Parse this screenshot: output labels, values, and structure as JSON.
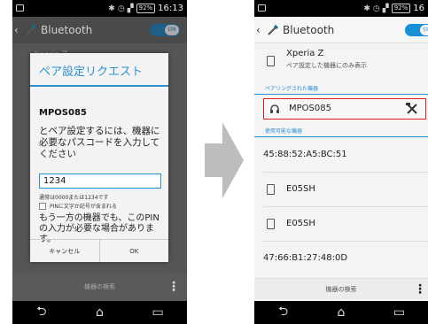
{
  "left_phone": {
    "status": {
      "time": "16:13",
      "battery": "92%"
    },
    "actionbar": {
      "back": "‹",
      "title": "Bluetooth",
      "toggle": "ON"
    },
    "background_item": "Xperia Z",
    "dialog": {
      "title": "ペア設定リクエスト",
      "device": "MPOS085",
      "message": "とペア設定するには、機器に必要なパスコードを入力してください",
      "input_value": "1234",
      "hint": "通常は0000または1234です",
      "checkbox_label": "PINに文字か記号が含まれる",
      "note": "もう一方の機器でも、このPINの入力が必要な場合があります。",
      "cancel": "キャンセル",
      "ok": "OK"
    },
    "bottombar": {
      "label": "機器の検索"
    }
  },
  "right_phone": {
    "status": {
      "time": "16",
      "battery": "92%"
    },
    "actionbar": {
      "back": "‹",
      "title": "Bluetooth",
      "toggle": "ON"
    },
    "own_device": {
      "name": "Xperia Z",
      "sub": "ペア設定した機器にのみ表示"
    },
    "paired_header": "ペアリングされた機器",
    "paired_device": "MPOS085",
    "available_header": "使用可能な機器",
    "available": [
      {
        "name": "45:88:52:A5:BC:51",
        "icon": "none"
      },
      {
        "name": "E05SH",
        "icon": "phone-icon"
      },
      {
        "name": "E05SH",
        "icon": "phone-icon"
      },
      {
        "name": "47:66:B1:27:48:0D",
        "icon": "none"
      }
    ],
    "bottombar": {
      "label": "機器の検索"
    }
  },
  "nav": {
    "back": "⮌",
    "home": "⌂",
    "recent": "▭"
  },
  "colors": {
    "accent": "#2b8fd0",
    "highlight": "#e02020",
    "arrow": "#bdbdbd"
  }
}
